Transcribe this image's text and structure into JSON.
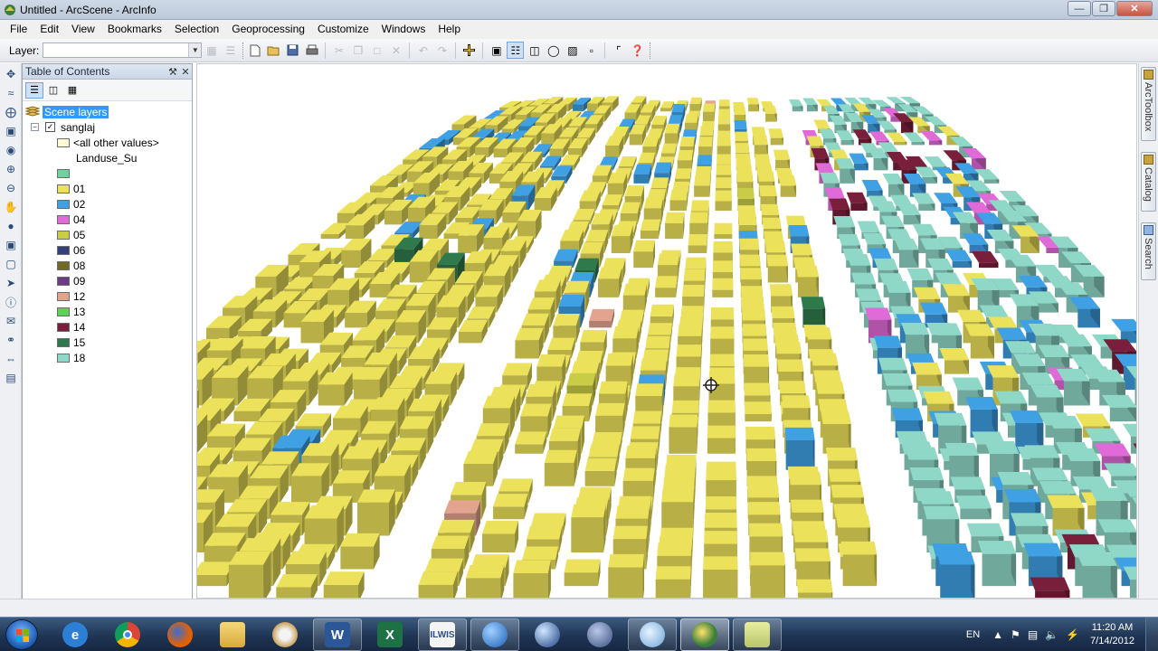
{
  "window": {
    "title": "Untitled - ArcScene - ArcInfo",
    "minimize_icon": "minimize-icon",
    "maximize_icon": "restore-icon",
    "close_icon": "close-icon"
  },
  "menu": [
    "File",
    "Edit",
    "View",
    "Bookmarks",
    "Selection",
    "Geoprocessing",
    "Customize",
    "Windows",
    "Help"
  ],
  "toolbar": {
    "layer_label": "Layer:",
    "layer_value": ""
  },
  "toc": {
    "title": "Table of Contents",
    "scene_group": "Scene layers",
    "layer": {
      "name": "sanglaj",
      "checked": true
    },
    "other_values": "<all other values>",
    "field": "Landuse_Su",
    "classes": [
      {
        "label": "",
        "color": "#6fd2a1"
      },
      {
        "label": "01",
        "color": "#ece15a"
      },
      {
        "label": "02",
        "color": "#3fa0e3"
      },
      {
        "label": "04",
        "color": "#e06ad8"
      },
      {
        "label": "05",
        "color": "#c9cc46"
      },
      {
        "label": "06",
        "color": "#33407a"
      },
      {
        "label": "08",
        "color": "#6f6a27"
      },
      {
        "label": "09",
        "color": "#6a3c86"
      },
      {
        "label": "12",
        "color": "#e3a48f"
      },
      {
        "label": "13",
        "color": "#5bd35a"
      },
      {
        "label": "14",
        "color": "#7a1f3b"
      },
      {
        "label": "15",
        "color": "#2f7a4c"
      },
      {
        "label": "18",
        "color": "#8fd8c8"
      }
    ]
  },
  "right_dock": [
    "ArcToolbox",
    "Catalog",
    "Search"
  ],
  "taskbar": {
    "language": "EN",
    "time": "11:20 AM",
    "date": "7/14/2012",
    "apps": [
      "internet-explorer",
      "chrome",
      "firefox",
      "file-explorer",
      "paint",
      "word",
      "excel",
      "ilwis",
      "arcmap-globe",
      "google-earth",
      "arcgis-server",
      "magnifier-search",
      "arcscene",
      "notes"
    ]
  }
}
